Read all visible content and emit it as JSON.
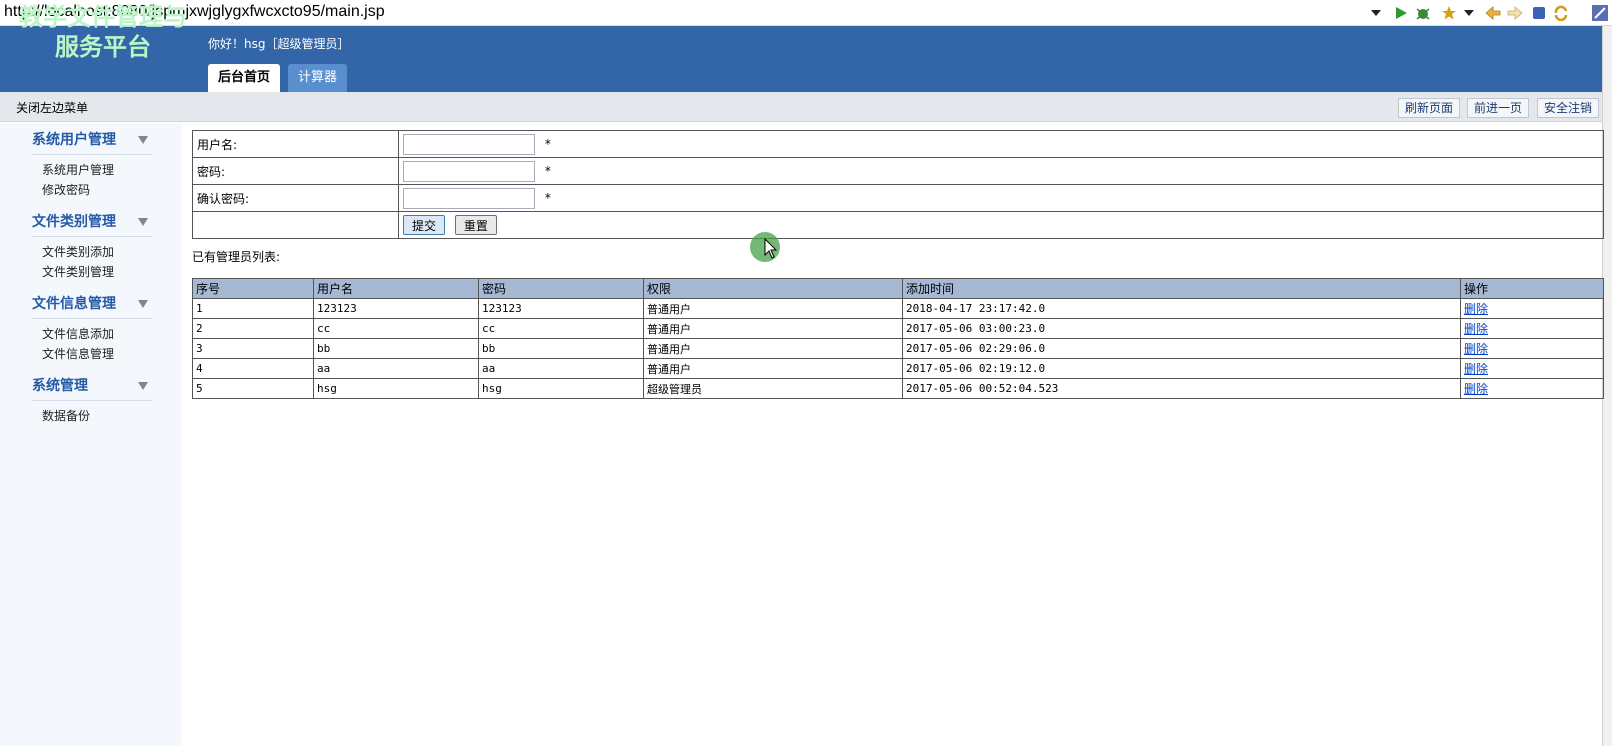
{
  "browser": {
    "url": "http://localhost:8080/jspmjxwjglygxfwcxcto95/main.jsp",
    "toolbar_icons": [
      "dropdown-icon",
      "run-icon",
      "debug-icon",
      "favorite-icon",
      "back-icon",
      "forward-icon",
      "stop-icon",
      "refresh-icon"
    ]
  },
  "header": {
    "logo_text": "教学文件管理与服务平台",
    "greeting": "你好！hsg［超级管理员］",
    "tabs": [
      {
        "label": "后台首页",
        "active": true
      },
      {
        "label": "计算器",
        "active": false
      }
    ]
  },
  "subbar": {
    "close_menu": "关闭左边菜单",
    "refresh": "刷新页面",
    "forward": "前进一页",
    "logout": "安全注销"
  },
  "sidebar": {
    "groups": [
      {
        "title": "系统用户管理",
        "items": [
          "系统用户管理",
          "修改密码"
        ]
      },
      {
        "title": "文件类别管理",
        "items": [
          "文件类别添加",
          "文件类别管理"
        ]
      },
      {
        "title": "文件信息管理",
        "items": [
          "文件信息添加",
          "文件信息管理"
        ]
      },
      {
        "title": "系统管理",
        "items": [
          "数据备份"
        ]
      }
    ]
  },
  "form": {
    "username_label": "用户名:",
    "password_label": "密码:",
    "confirm_label": "确认密码:",
    "required_mark": "*",
    "submit": "提交",
    "reset": "重置"
  },
  "list": {
    "title": "已有管理员列表:",
    "headers": [
      "序号",
      "用户名",
      "密码",
      "权限",
      "添加时间",
      "操作"
    ],
    "rows": [
      [
        "1",
        "123123",
        "123123",
        "普通用户",
        "2018-04-17 23:17:42.0",
        "删除"
      ],
      [
        "2",
        "cc",
        "cc",
        "普通用户",
        "2017-05-06 03:00:23.0",
        "删除"
      ],
      [
        "3",
        "bb",
        "bb",
        "普通用户",
        "2017-05-06 02:29:06.0",
        "删除"
      ],
      [
        "4",
        "aa",
        "aa",
        "普通用户",
        "2017-05-06 02:19:12.0",
        "删除"
      ],
      [
        "5",
        "hsg",
        "hsg",
        "超级管理员",
        "2017-05-06 00:52:04.523",
        "删除"
      ]
    ]
  },
  "colors": {
    "header_bg": "#3366a8",
    "logo_text": "#b9f5c6",
    "table_header_bg": "#a5b8d4",
    "table_border": "#37a0a0",
    "link": "#0044cc"
  }
}
